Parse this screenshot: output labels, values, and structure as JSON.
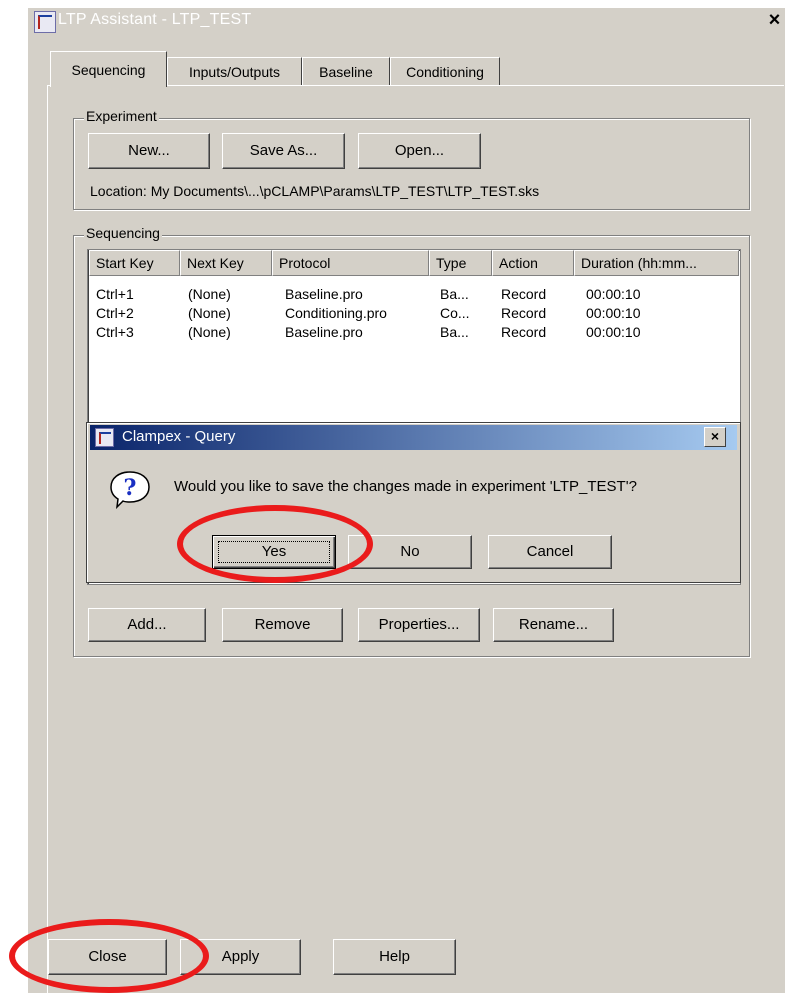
{
  "window": {
    "title": "LTP Assistant - LTP_TEST",
    "close_glyph": "×"
  },
  "tabs": [
    {
      "label": "Sequencing",
      "active": true
    },
    {
      "label": "Inputs/Outputs",
      "active": false
    },
    {
      "label": "Baseline",
      "active": false
    },
    {
      "label": "Conditioning",
      "active": false
    }
  ],
  "experiment": {
    "legend": "Experiment",
    "new_label": "New...",
    "save_as_label": "Save As...",
    "open_label": "Open...",
    "location": "Location: My Documents\\...\\pCLAMP\\Params\\LTP_TEST\\LTP_TEST.sks"
  },
  "sequencing": {
    "legend": "Sequencing",
    "columns": [
      "Start Key",
      "Next Key",
      "Protocol",
      "Type",
      "Action",
      "Duration (hh:mm..."
    ],
    "rows": [
      [
        "Ctrl+1",
        "(None)",
        "Baseline.pro",
        "Ba...",
        "Record",
        "00:00:10"
      ],
      [
        "Ctrl+2",
        "(None)",
        "Conditioning.pro",
        "Co...",
        "Record",
        "00:00:10"
      ],
      [
        "Ctrl+3",
        "(None)",
        "Baseline.pro",
        "Ba...",
        "Record",
        "00:00:10"
      ]
    ],
    "add_label": "Add...",
    "remove_label": "Remove",
    "properties_label": "Properties...",
    "rename_label": "Rename..."
  },
  "dialog": {
    "title": "Clampex - Query",
    "close_glyph": "×",
    "message": "Would you like to save the changes made in experiment 'LTP_TEST'?",
    "icon": "question-icon",
    "yes_label": "Yes",
    "no_label": "No",
    "cancel_label": "Cancel"
  },
  "footer": {
    "close_label": "Close",
    "apply_label": "Apply",
    "help_label": "Help"
  },
  "colors": {
    "face": "#d4d0c8",
    "dialog_title_start": "#0a246a",
    "dialog_title_end": "#a6caf0",
    "annotation_red": "#ea1b1b"
  }
}
